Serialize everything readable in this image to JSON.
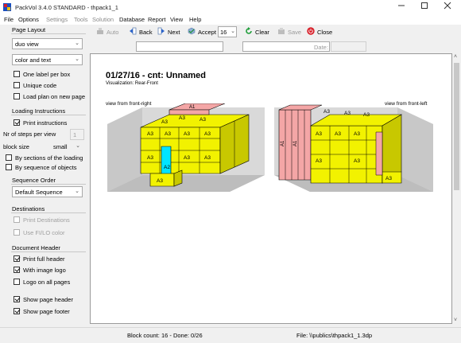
{
  "window": {
    "title": "PackVol 3.4.0 STANDARD - thpack1_1"
  },
  "menu": [
    {
      "label": "File",
      "enabled": true
    },
    {
      "label": "Options",
      "enabled": true
    },
    {
      "label": "Settings",
      "enabled": false
    },
    {
      "label": "Tools",
      "enabled": false
    },
    {
      "label": "Solution",
      "enabled": false
    },
    {
      "label": "Database",
      "enabled": true
    },
    {
      "label": "Report",
      "enabled": true
    },
    {
      "label": "View",
      "enabled": true
    },
    {
      "label": "Help",
      "enabled": true
    }
  ],
  "toolbar": {
    "auto": "Auto",
    "back": "Back",
    "next": "Next",
    "accept": "Accept",
    "accept_value": "16",
    "clear": "Clear",
    "save": "Save",
    "close": "Close",
    "date_label": "Date:"
  },
  "sidebar": {
    "page_layout": {
      "title": "Page Layout",
      "view_select": "duo view",
      "color_select": "color and text",
      "one_label": {
        "label": "One label per box",
        "checked": false
      },
      "unique_code": {
        "label": "Unique code",
        "checked": false
      },
      "load_plan": {
        "label": "Load plan on new page",
        "checked": false
      }
    },
    "loading": {
      "title": "Loading Instructions",
      "print": {
        "label": "Print instructions",
        "checked": true
      },
      "steps_label": "Nr of steps per view",
      "steps_value": "1",
      "block_size_label": "block size",
      "block_size_value": "small",
      "by_sections": {
        "label": "By sections of the loading",
        "checked": false
      },
      "by_sequence": {
        "label": "By sequence of objects",
        "checked": false
      }
    },
    "sequence": {
      "title": "Sequence Order",
      "value": "Default Sequence"
    },
    "destinations": {
      "title": "Destinations",
      "print_dest": {
        "label": "Print Destinations",
        "checked": false
      },
      "use_color": {
        "label": "Use FI/LO color",
        "checked": false
      }
    },
    "document_header": {
      "title": "Document Header",
      "print_full": {
        "label": "Print full header",
        "checked": true
      },
      "with_logo": {
        "label": "With image logo",
        "checked": true
      },
      "logo_all": {
        "label": "Logo on all pages",
        "checked": false
      },
      "show_header": {
        "label": "Show page header",
        "checked": true
      },
      "show_footer": {
        "label": "Show page footer",
        "checked": true
      }
    }
  },
  "report": {
    "heading": "01/27/16 - cnt: Unnamed",
    "visualization": "Visualization: Rear-Front",
    "view_left": "view from front-right",
    "view_right": "view from front-left",
    "box_label": "A3",
    "box_label_cyan": "A2",
    "box_label_pink": "A1"
  },
  "status": {
    "block_count": "Block count: 16 - Done: 0/26",
    "file": "File: \\\\publics\\thpack1_1.3dp"
  },
  "colors": {
    "yellow": "#f2f200",
    "yellow_side": "#c8c800",
    "pink": "#f4a6a6",
    "pink_dark": "#d98585",
    "cyan": "#00e5ff",
    "floor": "#bdbdbd",
    "accent_red": "#d8202a"
  },
  "icons": {
    "app": "packvol-app-icon",
    "auto": "auto-icon",
    "back": "back-arrow-icon",
    "next": "next-arrow-icon",
    "accept": "accept-icon",
    "clear": "clear-icon",
    "save": "save-icon",
    "close": "close-power-icon"
  }
}
